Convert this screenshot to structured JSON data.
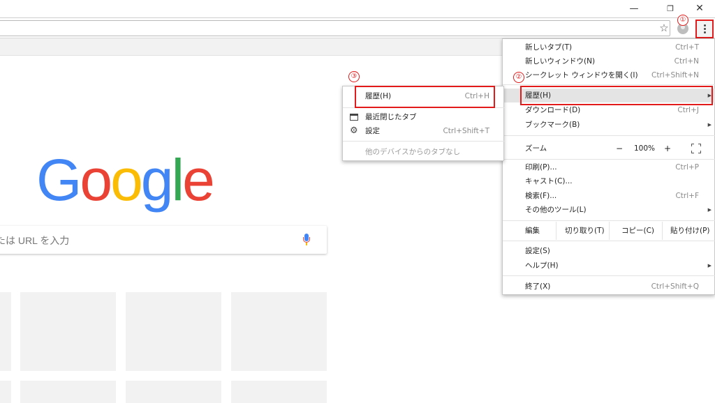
{
  "window": {
    "minimize_icon": "minimize-icon",
    "restore_icon": "restore-icon",
    "close_icon": "close-icon"
  },
  "toolbar": {
    "bookmark_icon": "star-icon",
    "profile_icon": "profile-icon",
    "menu_icon": "kebab-menu-icon"
  },
  "ntp": {
    "logo": [
      "G",
      "o",
      "o",
      "g",
      "l",
      "e"
    ],
    "search_placeholder": "たは URL を入力",
    "mic_icon": "mic-icon"
  },
  "menu": {
    "new_tab": {
      "label": "新しいタブ(T)",
      "shortcut": "Ctrl+T"
    },
    "new_window": {
      "label": "新しいウィンドウ(N)",
      "shortcut": "Ctrl+N"
    },
    "incognito": {
      "label": "シークレット ウィンドウを開く(I)",
      "shortcut": "Ctrl+Shift+N"
    },
    "history": {
      "label": "履歴(H)"
    },
    "downloads": {
      "label": "ダウンロード(D)",
      "shortcut": "Ctrl+J"
    },
    "bookmarks": {
      "label": "ブックマーク(B)"
    },
    "zoom": {
      "label": "ズーム",
      "minus": "−",
      "value": "100%",
      "plus": "+"
    },
    "print": {
      "label": "印刷(P)...",
      "shortcut": "Ctrl+P"
    },
    "cast": {
      "label": "キャスト(C)..."
    },
    "find": {
      "label": "検索(F)...",
      "shortcut": "Ctrl+F"
    },
    "more_tools": {
      "label": "その他のツール(L)"
    },
    "edit": {
      "label": "編集",
      "cut": "切り取り(T)",
      "copy": "コピー(C)",
      "paste": "貼り付け(P)"
    },
    "settings": {
      "label": "設定(S)"
    },
    "help": {
      "label": "ヘルプ(H)"
    },
    "exit": {
      "label": "終了(X)",
      "shortcut": "Ctrl+Shift+Q"
    }
  },
  "history_submenu": {
    "history": {
      "label": "履歴(H)",
      "shortcut": "Ctrl+H"
    },
    "recently_closed": {
      "label": "最近閉じたタブ"
    },
    "settings": {
      "label": "設定",
      "shortcut": "Ctrl+Shift+T"
    },
    "other_devices": {
      "label": "他のデバイスからのタブなし"
    }
  },
  "callouts": {
    "step1": "①",
    "step2": "②",
    "step3": "③"
  },
  "colors": {
    "callout": "#e21a1a",
    "google_blue": "#4285f4",
    "google_red": "#ea4335",
    "google_yellow": "#fbbc05",
    "google_green": "#34a853"
  }
}
